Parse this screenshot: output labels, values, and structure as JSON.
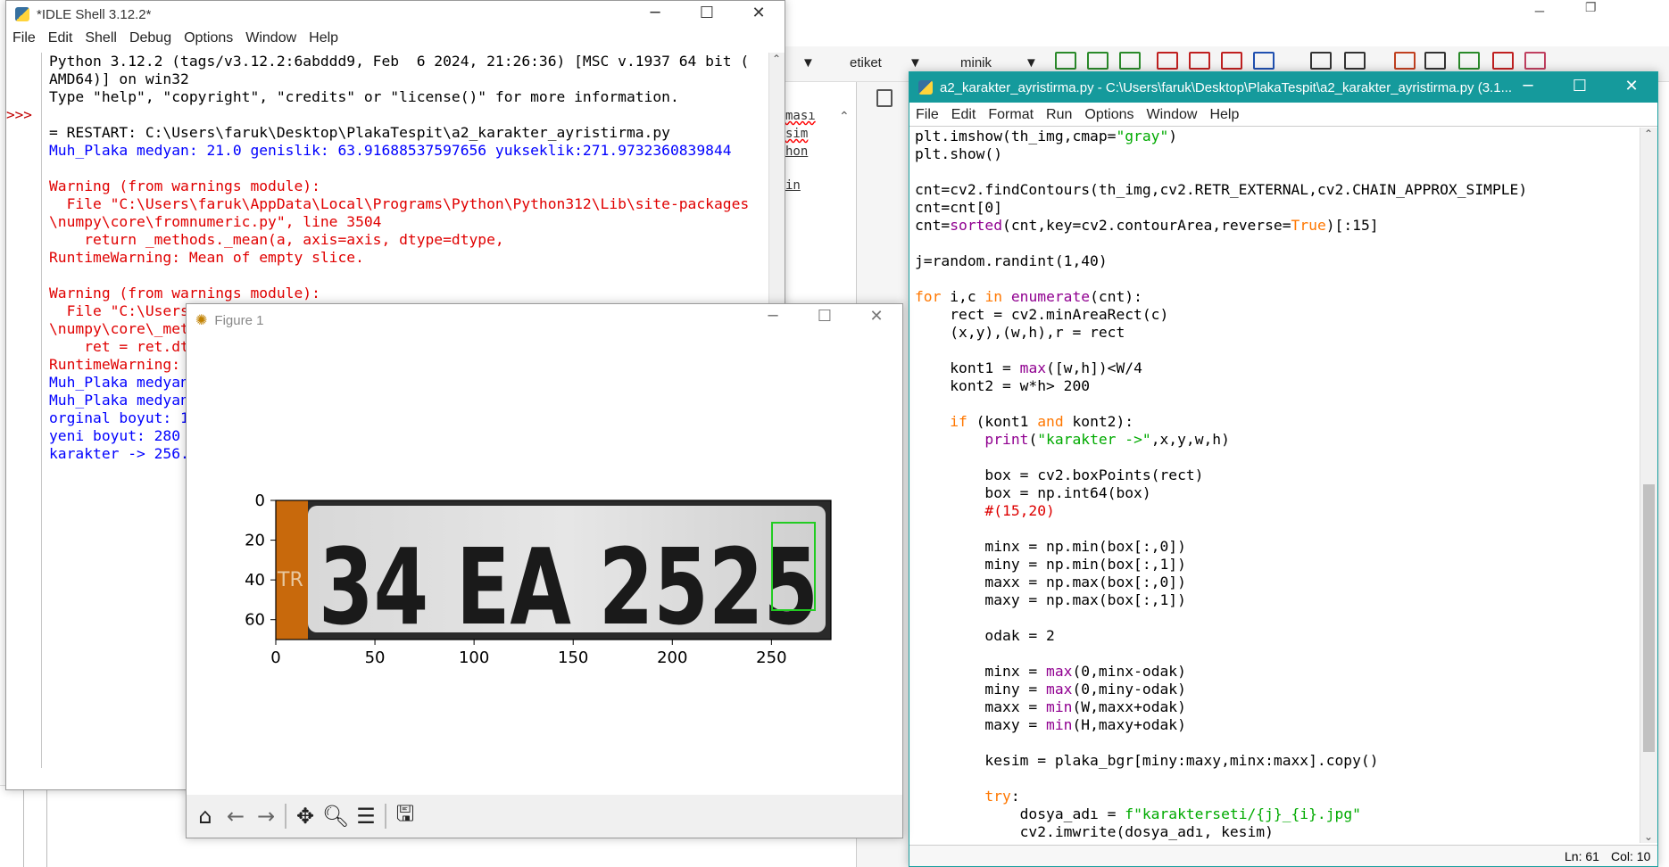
{
  "shell": {
    "title": "*IDLE Shell 3.12.2*",
    "menu": [
      "File",
      "Edit",
      "Shell",
      "Debug",
      "Options",
      "Window",
      "Help"
    ],
    "prompt": ">>>",
    "lines": [
      {
        "t": "Python 3.12.2 (tags/v3.12.2:6abddd9, Feb  6 2024, 21:26:36) [MSC v.1937 64 bit (",
        "c": "blk"
      },
      {
        "t": "AMD64)] on win32",
        "c": "blk"
      },
      {
        "t": "Type \"help\", \"copyright\", \"credits\" or \"license()\" for more information.",
        "c": "blk"
      },
      {
        "t": "",
        "c": "blk"
      },
      {
        "t": "= RESTART: C:\\Users\\faruk\\Desktop\\PlakaTespit\\a2_karakter_ayristirma.py",
        "c": "blk"
      },
      {
        "t": "Muh_Plaka medyan: 21.0 genislik: 63.91688537597656 yukseklik:271.9732360839844",
        "c": "blu"
      },
      {
        "t": "",
        "c": "blk"
      },
      {
        "t": "Warning (from warnings module):",
        "c": "red"
      },
      {
        "t": "  File \"C:\\Users\\faruk\\AppData\\Local\\Programs\\Python\\Python312\\Lib\\site-packages",
        "c": "red"
      },
      {
        "t": "\\numpy\\core\\fromnumeric.py\", line 3504",
        "c": "red"
      },
      {
        "t": "    return _methods._mean(a, axis=axis, dtype=dtype,",
        "c": "red"
      },
      {
        "t": "RuntimeWarning: Mean of empty slice.",
        "c": "red"
      },
      {
        "t": "",
        "c": "blk"
      },
      {
        "t": "Warning (from warnings module):",
        "c": "red"
      },
      {
        "t": "  File \"C:\\Users",
        "c": "red"
      },
      {
        "t": "\\numpy\\core\\_met",
        "c": "red"
      },
      {
        "t": "    ret = ret.dt",
        "c": "red"
      },
      {
        "t": "RuntimeWarning:",
        "c": "red"
      },
      {
        "t": "Muh_Plaka medyan",
        "c": "blu"
      },
      {
        "t": "Muh_Plaka medyan",
        "c": "blu"
      },
      {
        "t": "orginal boyut: 1",
        "c": "blu"
      },
      {
        "t": "yeni boyut: 280",
        "c": "blu"
      },
      {
        "t": "karakter -> 256.",
        "c": "blu"
      }
    ]
  },
  "background": {
    "combo1": "etiket",
    "combo2": "minik",
    "words": [
      "ması",
      "sim",
      "hon",
      "in"
    ]
  },
  "editor": {
    "title": "a2_karakter_ayristirma.py - C:\\Users\\faruk\\Desktop\\PlakaTespit\\a2_karakter_ayristirma.py (3.1...",
    "menu": [
      "File",
      "Edit",
      "Format",
      "Run",
      "Options",
      "Window",
      "Help"
    ],
    "status_ln": "Ln: 61",
    "status_col": "Col: 10",
    "code": [
      [
        [
          "plt.imshow(th_img,cmap=",
          ""
        ],
        [
          "\"gray\"",
          "str"
        ],
        [
          ")",
          ""
        ]
      ],
      [
        [
          "plt.show()",
          ""
        ]
      ],
      [
        [
          "",
          ""
        ]
      ],
      [
        [
          "cnt=cv2.findContours(th_img,cv2.RETR_EXTERNAL,cv2.CHAIN_APPROX_SIMPLE)",
          ""
        ]
      ],
      [
        [
          "cnt=cnt[0]",
          ""
        ]
      ],
      [
        [
          "cnt=",
          ""
        ],
        [
          "sorted",
          "bi"
        ],
        [
          "(cnt,key=cv2.contourArea,reverse=",
          ""
        ],
        [
          "True",
          "kw"
        ],
        [
          ")[:15]",
          ""
        ]
      ],
      [
        [
          "",
          ""
        ]
      ],
      [
        [
          "j=random.randint(1,40)",
          ""
        ]
      ],
      [
        [
          "",
          ""
        ]
      ],
      [
        [
          "for",
          "kw"
        ],
        [
          " i,c ",
          ""
        ],
        [
          "in",
          "kw"
        ],
        [
          " ",
          ""
        ],
        [
          "enumerate",
          "bi"
        ],
        [
          "(cnt):",
          ""
        ]
      ],
      [
        [
          "    rect = cv2.minAreaRect(c)",
          ""
        ]
      ],
      [
        [
          "    (x,y),(w,h),r = rect",
          ""
        ]
      ],
      [
        [
          "",
          ""
        ]
      ],
      [
        [
          "    kont1 = ",
          ""
        ],
        [
          "max",
          "bi"
        ],
        [
          "([w,h])<W/4",
          ""
        ]
      ],
      [
        [
          "    kont2 = w*h> 200",
          ""
        ]
      ],
      [
        [
          "",
          ""
        ]
      ],
      [
        [
          "    ",
          ""
        ],
        [
          "if",
          "kw"
        ],
        [
          " (kont1 ",
          ""
        ],
        [
          "and",
          "kw"
        ],
        [
          " kont2):",
          ""
        ]
      ],
      [
        [
          "        ",
          ""
        ],
        [
          "print",
          "bi"
        ],
        [
          "(",
          ""
        ],
        [
          "\"karakter ->\"",
          "str"
        ],
        [
          ",x,y,w,h)",
          ""
        ]
      ],
      [
        [
          "",
          ""
        ]
      ],
      [
        [
          "        box = cv2.boxPoints(rect)",
          ""
        ]
      ],
      [
        [
          "        box = np.int64(box)",
          ""
        ]
      ],
      [
        [
          "        ",
          ""
        ],
        [
          "#(15,20)",
          "cm"
        ]
      ],
      [
        [
          "",
          ""
        ]
      ],
      [
        [
          "        minx = np.min(box[:,0])",
          ""
        ]
      ],
      [
        [
          "        miny = np.min(box[:,1])",
          ""
        ]
      ],
      [
        [
          "        maxx = np.max(box[:,0])",
          ""
        ]
      ],
      [
        [
          "        maxy = np.max(box[:,1])",
          ""
        ]
      ],
      [
        [
          "",
          ""
        ]
      ],
      [
        [
          "        odak = 2",
          ""
        ]
      ],
      [
        [
          "",
          ""
        ]
      ],
      [
        [
          "        minx = ",
          ""
        ],
        [
          "max",
          "bi"
        ],
        [
          "(0,minx-odak)",
          ""
        ]
      ],
      [
        [
          "        miny = ",
          ""
        ],
        [
          "max",
          "bi"
        ],
        [
          "(0,miny-odak)",
          ""
        ]
      ],
      [
        [
          "        maxx = ",
          ""
        ],
        [
          "min",
          "bi"
        ],
        [
          "(W,maxx+odak)",
          ""
        ]
      ],
      [
        [
          "        maxy = ",
          ""
        ],
        [
          "min",
          "bi"
        ],
        [
          "(H,maxy+odak)",
          ""
        ]
      ],
      [
        [
          "",
          ""
        ]
      ],
      [
        [
          "        kesim = plaka_bgr[miny:maxy,minx:maxx].copy()",
          ""
        ]
      ],
      [
        [
          "",
          ""
        ]
      ],
      [
        [
          "        ",
          ""
        ],
        [
          "try",
          "kw"
        ],
        [
          ":",
          ""
        ]
      ],
      [
        [
          "            dosya_adı = ",
          ""
        ],
        [
          "f\"karakterseti/{j}_{i}.jpg\"",
          "str"
        ]
      ],
      [
        [
          "            cv2.imwrite(dosya_adı, kesim)",
          ""
        ]
      ]
    ]
  },
  "figure": {
    "title": "Figure 1",
    "plate_text": "34 EA 2525",
    "plate_side": "TR",
    "xticks": [
      "0",
      "50",
      "100",
      "150",
      "200",
      "250"
    ],
    "yticks": [
      "0",
      "20",
      "40",
      "60"
    ],
    "box_color": "#22cc22",
    "toolbar": [
      "home-icon",
      "back-icon",
      "forward-icon",
      "pan-icon",
      "zoom-icon",
      "configure-icon",
      "save-icon"
    ]
  }
}
